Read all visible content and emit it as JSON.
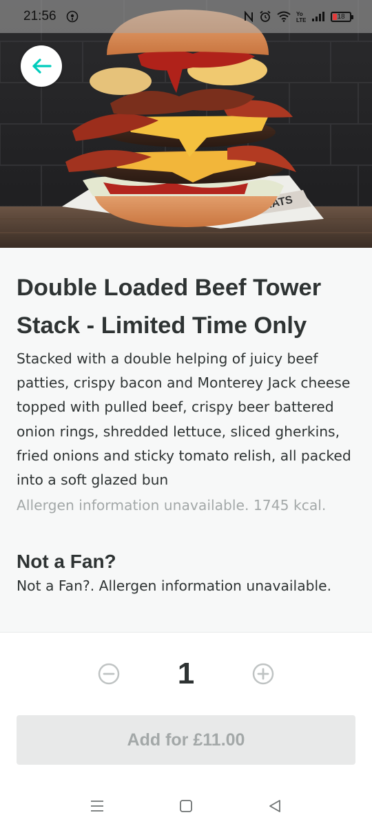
{
  "status_bar": {
    "time": "21:56",
    "battery_level": "18",
    "icons": [
      "podcast-icon",
      "nfc-icon",
      "alarm-icon",
      "wifi-icon",
      "volte-icon",
      "signal-icon",
      "battery-icon"
    ]
  },
  "hero": {
    "alt": "burger-photo"
  },
  "product": {
    "title": "Double Loaded Beef Tower Stack - Limited Time Only",
    "description": "Stacked with a double helping of juicy beef patties, crispy bacon and Monterey Jack cheese topped with pulled beef, crispy beer battered onion rings, shredded lettuce, sliced gherkins, fried onions and sticky tomato relish, all packed into a soft glazed bun",
    "allergen_info": "Allergen information unavailable. 1745 kcal."
  },
  "options": {
    "title": "Not a Fan?",
    "subtitle": "Not a Fan?. Allergen information unavailable."
  },
  "quantity": {
    "value": "1"
  },
  "add_button": {
    "label": "Add for £11.00"
  },
  "colors": {
    "accent": "#00ccbc",
    "text": "#2e3333",
    "muted": "#a3a8a8",
    "button_disabled_bg": "#e8e9e9"
  },
  "nav_icons": [
    "menu-icon",
    "home-icon",
    "back-icon"
  ]
}
